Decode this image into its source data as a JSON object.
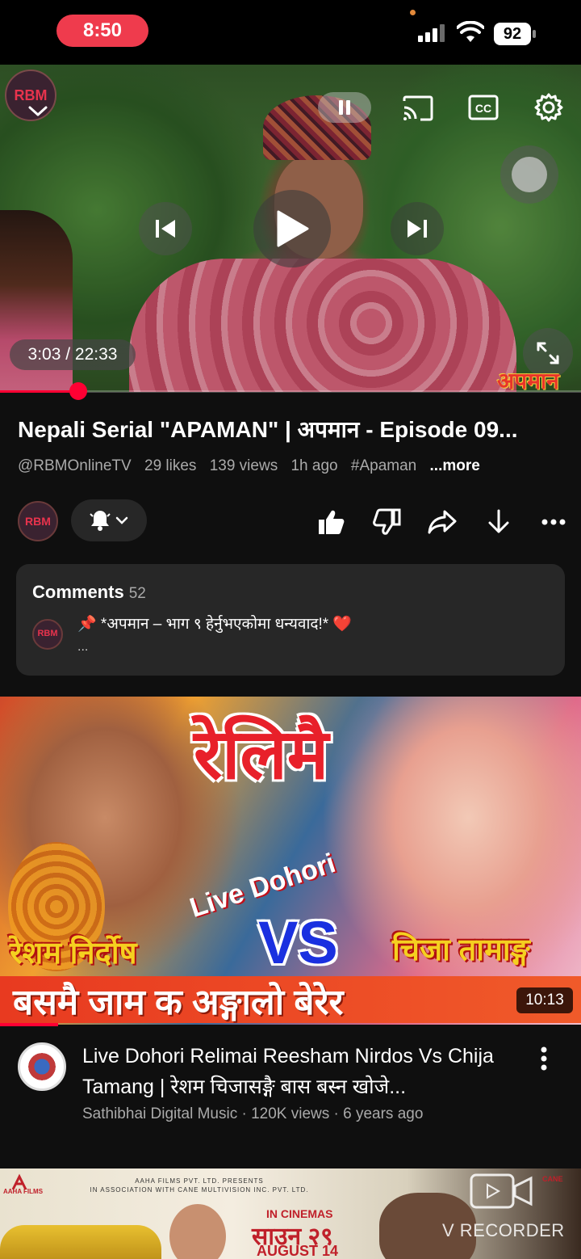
{
  "status_bar": {
    "time": "8:50",
    "battery": "92",
    "icons": [
      "signal-icon",
      "wifi-icon",
      "battery-icon"
    ]
  },
  "player": {
    "channel_logo_text": "RBM",
    "elapsed": "3:03",
    "duration": "22:33",
    "time_display": "3:03 / 22:33",
    "progress_fraction": 0.135,
    "overlay_watermark": "अपमान",
    "controls": [
      "chevron-down-icon",
      "pause-icon",
      "cast-icon",
      "cc-icon",
      "gear-icon",
      "previous-icon",
      "play-icon",
      "next-icon",
      "fullscreen-icon"
    ],
    "cc_label": "CC"
  },
  "video": {
    "title": "Nepali Serial \"APAMAN\" | अपमान - Episode 09...",
    "channel_handle": "@RBMOnlineTV",
    "likes": "29 likes",
    "views": "139 views",
    "age": "1h ago",
    "hashtag": "#Apaman",
    "more_label": "...more"
  },
  "actions": {
    "avatar_text": "RBM",
    "icons": [
      "bell-icon",
      "chevron-down-icon",
      "like-icon",
      "dislike-icon",
      "share-icon",
      "download-icon",
      "more-icon"
    ]
  },
  "comments": {
    "heading": "Comments",
    "count": "52",
    "avatar_text": "RBM",
    "pinned_text": "📌 *अपमान – भाग ९ हेर्नुभएकोमा धन्यवाद!* ❤️",
    "ellipsis": "..."
  },
  "next_video": {
    "thumb_title": "रेलिमै",
    "thumb_live": "Live Dohori",
    "thumb_vs": "VS",
    "thumb_name_left": "रेशम निर्दोष",
    "thumb_name_right": "चिजा तामाङ्ग",
    "thumb_banner": "बसमै जाम क अङ्गालो बेरेर",
    "duration": "10:13",
    "progress_fraction": 0.1,
    "title": "Live Dohori Relimai Reesham Nirdos Vs Chija Tamang | रेशम चिजासङ्गै बास बस्न खोजे...",
    "channel": "Sathibhai Digital Music",
    "views": "120K views",
    "age": "6 years ago",
    "meta": "Sathibhai Digital Music · 120K views · 6 years ago"
  },
  "ad": {
    "logo_label": "AAHA FILMS",
    "presents_line1": "AAHA FILMS PVT. LTD. PRESENTS",
    "presents_line2": "IN ASSOCIATION WITH CANE MULTIVISION INC. PVT. LTD.",
    "in_cinemas": "IN CINEMAS",
    "date_np": "साउन २९",
    "date_en": "AUGUST 14",
    "cane_label": "CANE"
  },
  "recorder": {
    "label": "V RECORDER"
  },
  "colors": {
    "accent_red": "#ff0033",
    "time_pill": "#ef3b4d",
    "background": "#0f0f0f",
    "card": "#272727"
  }
}
